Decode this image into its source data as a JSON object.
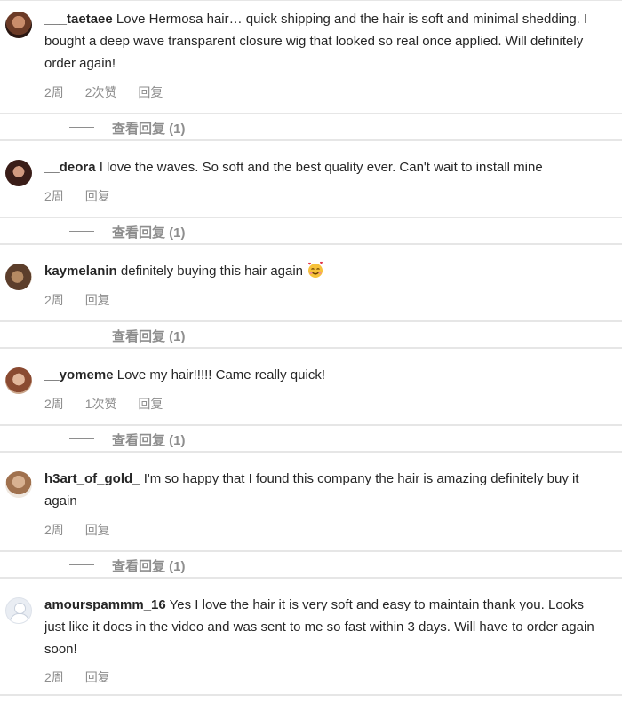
{
  "comments": [
    {
      "username": "___taetaee",
      "text": "Love Hermosa hair… quick shipping and the hair is soft and minimal shedding. I bought a deep wave transparent closure wig that looked so real once applied. Will definitely order again!",
      "time": "2周",
      "likes": "2次赞",
      "reply": "回复",
      "avatar_icon": "user-photo-avatar",
      "view_replies": "查看回复 (1)"
    },
    {
      "username": "__deora",
      "text": "I love the waves. So soft and the best quality ever. Can't wait to install mine",
      "time": "2周",
      "reply": "回复",
      "avatar_icon": "user-photo-avatar",
      "view_replies": "查看回复 (1)"
    },
    {
      "username": "kaymelanin",
      "text": "definitely buying this hair again",
      "emoji": "smiling-face-with-hearts-emoji",
      "time": "2周",
      "reply": "回复",
      "avatar_icon": "user-photo-avatar",
      "view_replies": "查看回复 (1)"
    },
    {
      "username": "__yomeme",
      "text": "Love my hair!!!!! Came really quick!",
      "time": "2周",
      "likes": "1次赞",
      "reply": "回复",
      "avatar_icon": "user-photo-avatar",
      "view_replies": "查看回复 (1)"
    },
    {
      "username": "h3art_of_gold_",
      "text": "I'm so happy that I found this company the hair is amazing definitely buy it again",
      "time": "2周",
      "reply": "回复",
      "avatar_icon": "user-photo-avatar",
      "view_replies": "查看回复 (1)"
    },
    {
      "username": "amourspammm_16",
      "text": "Yes I love the hair it is very soft and easy to maintain thank you. Looks just like it does in the video and was sent to me so fast within 3 days. Will have to order again soon!",
      "time": "2周",
      "reply": "回复",
      "avatar_icon": "default-user-avatar"
    }
  ],
  "colors": {
    "text": "#262626",
    "muted": "#8e8e8e",
    "divider": "#e6e6e6"
  }
}
